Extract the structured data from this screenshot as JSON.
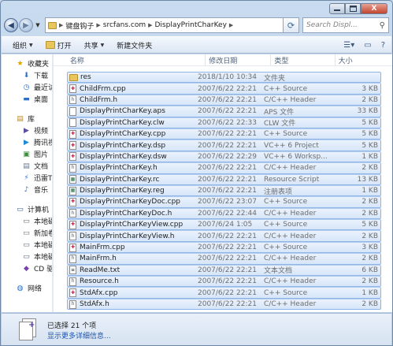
{
  "window": {
    "controls": {
      "minimize": "–",
      "maximize": "□",
      "close": "X"
    }
  },
  "address": {
    "segments": [
      "键盘钩子",
      "srcfans.com",
      "DisplayPrintCharKey"
    ],
    "search_placeholder": "Search Displ..."
  },
  "toolbar": {
    "organize": "组织",
    "open": "打开",
    "share": "共享",
    "new_folder": "新建文件夹"
  },
  "nav": {
    "items": [
      {
        "label": "收藏夹",
        "level": "top",
        "icon": "star-icon"
      },
      {
        "label": "下载",
        "level": "sub",
        "icon": "download-icon"
      },
      {
        "label": "最近访",
        "level": "sub",
        "icon": "recent-icon"
      },
      {
        "label": "桌面",
        "level": "sub",
        "icon": "desktop-icon"
      },
      {
        "label": "",
        "level": "gap",
        "icon": ""
      },
      {
        "label": "库",
        "level": "top",
        "icon": "library-icon"
      },
      {
        "label": "视频",
        "level": "sub",
        "icon": "video-icon"
      },
      {
        "label": "腾讯视",
        "level": "sub",
        "icon": "tencent-video-icon"
      },
      {
        "label": "图片",
        "level": "sub",
        "icon": "picture-icon"
      },
      {
        "label": "文档",
        "level": "sub",
        "icon": "document-icon"
      },
      {
        "label": "迅雷T",
        "level": "sub",
        "icon": "thunder-icon"
      },
      {
        "label": "音乐",
        "level": "sub",
        "icon": "music-icon"
      },
      {
        "label": "",
        "level": "gap",
        "icon": ""
      },
      {
        "label": "计算机",
        "level": "top",
        "icon": "computer-icon"
      },
      {
        "label": "本地磁",
        "level": "sub",
        "icon": "drive-icon"
      },
      {
        "label": "新加卷",
        "level": "sub",
        "icon": "drive-icon"
      },
      {
        "label": "本地磁",
        "level": "sub",
        "icon": "drive-icon"
      },
      {
        "label": "本地磁",
        "level": "sub",
        "icon": "drive-icon"
      },
      {
        "label": "CD 驱",
        "level": "sub",
        "icon": "visual-studio-icon"
      },
      {
        "label": "",
        "level": "gap",
        "icon": ""
      },
      {
        "label": "网络",
        "level": "top",
        "icon": "network-icon"
      }
    ]
  },
  "columns": {
    "name": "名称",
    "date": "修改日期",
    "type": "类型",
    "size": "大小"
  },
  "files": [
    {
      "name": "res",
      "date": "2018/1/10 10:34",
      "type": "文件夹",
      "size": "",
      "icon": "folder"
    },
    {
      "name": "ChildFrm.cpp",
      "date": "2007/6/22 22:21",
      "type": "C++ Source",
      "size": "3 KB",
      "icon": "cpp"
    },
    {
      "name": "ChildFrm.h",
      "date": "2007/6/22 22:21",
      "type": "C/C++ Header",
      "size": "2 KB",
      "icon": "h"
    },
    {
      "name": "DisplayPrintCharKey.aps",
      "date": "2007/6/22 22:21",
      "type": "APS 文件",
      "size": "33 KB",
      "icon": "file"
    },
    {
      "name": "DisplayPrintCharKey.clw",
      "date": "2007/6/22 22:33",
      "type": "CLW 文件",
      "size": "5 KB",
      "icon": "file"
    },
    {
      "name": "DisplayPrintCharKey.cpp",
      "date": "2007/6/22 22:21",
      "type": "C++ Source",
      "size": "5 KB",
      "icon": "cpp"
    },
    {
      "name": "DisplayPrintCharKey.dsp",
      "date": "2007/6/22 22:21",
      "type": "VC++ 6 Project",
      "size": "5 KB",
      "icon": "cpp"
    },
    {
      "name": "DisplayPrintCharKey.dsw",
      "date": "2007/6/22 22:29",
      "type": "VC++ 6 Worksp...",
      "size": "1 KB",
      "icon": "cpp"
    },
    {
      "name": "DisplayPrintCharKey.h",
      "date": "2007/6/22 22:21",
      "type": "C/C++ Header",
      "size": "2 KB",
      "icon": "h"
    },
    {
      "name": "DisplayPrintCharKey.rc",
      "date": "2007/6/22 22:21",
      "type": "Resource Script",
      "size": "13 KB",
      "icon": "rc"
    },
    {
      "name": "DisplayPrintCharKey.reg",
      "date": "2007/6/22 22:21",
      "type": "注册表项",
      "size": "1 KB",
      "icon": "reg"
    },
    {
      "name": "DisplayPrintCharKeyDoc.cpp",
      "date": "2007/6/22 23:07",
      "type": "C++ Source",
      "size": "2 KB",
      "icon": "cpp"
    },
    {
      "name": "DisplayPrintCharKeyDoc.h",
      "date": "2007/6/22 22:44",
      "type": "C/C++ Header",
      "size": "2 KB",
      "icon": "h"
    },
    {
      "name": "DisplayPrintCharKeyView.cpp",
      "date": "2007/6/24 1:05",
      "type": "C++ Source",
      "size": "5 KB",
      "icon": "cpp"
    },
    {
      "name": "DisplayPrintCharKeyView.h",
      "date": "2007/6/22 22:21",
      "type": "C/C++ Header",
      "size": "2 KB",
      "icon": "h"
    },
    {
      "name": "MainFrm.cpp",
      "date": "2007/6/22 22:21",
      "type": "C++ Source",
      "size": "3 KB",
      "icon": "cpp"
    },
    {
      "name": "MainFrm.h",
      "date": "2007/6/22 22:21",
      "type": "C/C++ Header",
      "size": "2 KB",
      "icon": "h"
    },
    {
      "name": "ReadMe.txt",
      "date": "2007/6/22 22:21",
      "type": "文本文档",
      "size": "6 KB",
      "icon": "txt"
    },
    {
      "name": "Resource.h",
      "date": "2007/6/22 22:21",
      "type": "C/C++ Header",
      "size": "2 KB",
      "icon": "h"
    },
    {
      "name": "StdAfx.cpp",
      "date": "2007/6/22 22:21",
      "type": "C++ Source",
      "size": "1 KB",
      "icon": "cpp"
    },
    {
      "name": "StdAfx.h",
      "date": "2007/6/22 22:21",
      "type": "C/C++ Header",
      "size": "2 KB",
      "icon": "h"
    }
  ],
  "status": {
    "selected": "已选择 21 个项",
    "details_link": "显示更多详细信息..."
  },
  "colors": {
    "selection": "#d7e6f9",
    "selection_border": "#8fb5e8",
    "link": "#1a55b5"
  }
}
